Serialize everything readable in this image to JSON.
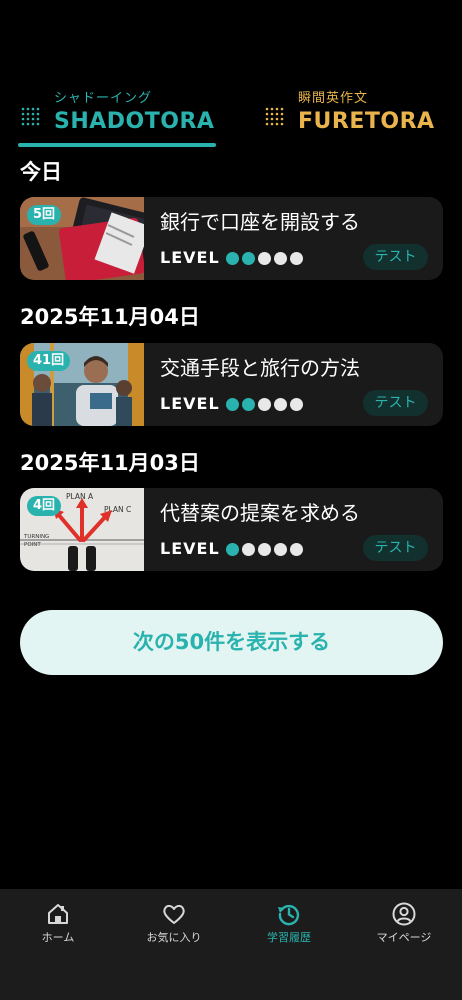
{
  "tabs": [
    {
      "sub": "シャドーイング",
      "main": "SHADOTORA",
      "color": "#2ab3ae",
      "active": true
    },
    {
      "sub": "瞬間英作文",
      "main": "FURETORA",
      "color": "#e9b44c",
      "active": false
    }
  ],
  "sections": [
    {
      "date": "今日",
      "cards": [
        {
          "count": "5回",
          "title": "銀行で口座を開設する",
          "level_label": "LEVEL",
          "level": 2,
          "level_max": 5,
          "test_label": "テスト"
        }
      ]
    },
    {
      "date": "2025年11月04日",
      "cards": [
        {
          "count": "41回",
          "title": "交通手段と旅行の方法",
          "level_label": "LEVEL",
          "level": 2,
          "level_max": 5,
          "test_label": "テスト"
        }
      ]
    },
    {
      "date": "2025年11月03日",
      "cards": [
        {
          "count": "4回",
          "title": "代替案の提案を求める",
          "level_label": "LEVEL",
          "level": 1,
          "level_max": 5,
          "test_label": "テスト"
        }
      ]
    }
  ],
  "thumb3_text": {
    "plan_a": "PLAN A",
    "plan_c": "PLAN C",
    "turning": "TURNING",
    "point": "POINT"
  },
  "more_button": "次の50件を表示する",
  "nav": [
    {
      "label": "ホーム",
      "icon": "home-icon",
      "active": false
    },
    {
      "label": "お気に入り",
      "icon": "heart-icon",
      "active": false
    },
    {
      "label": "学習履歴",
      "icon": "history-icon",
      "active": true
    },
    {
      "label": "マイページ",
      "icon": "user-icon",
      "active": false
    }
  ],
  "colors": {
    "accent": "#2ab3ae",
    "secondary": "#e9b44c",
    "background": "#000000",
    "card": "#1a1a1a"
  }
}
